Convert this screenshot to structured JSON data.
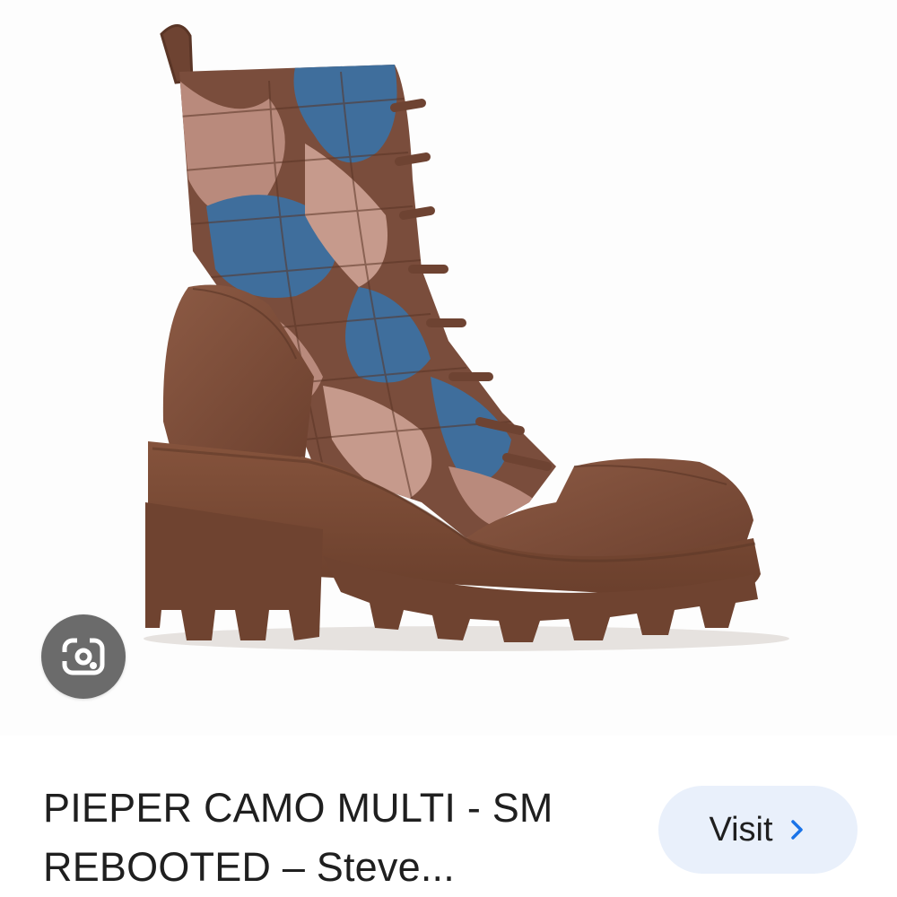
{
  "result": {
    "title_line_1": "PIEPER CAMO MULTI - SM",
    "title_line_2": "REBOOTED – Steve...",
    "image_alt": "PIEPER CAMO MULTI - SM REBOOTED boot"
  },
  "actions": {
    "visit_label": "Visit",
    "lens_icon": "google-lens-icon",
    "chevron_icon": "chevron-right-icon"
  },
  "colors": {
    "visit_bg": "#e9f0fb",
    "accent": "#1a73e8",
    "lens_bg": "#6b6b6b",
    "boot_brown": "#7a4a35",
    "camo_blue": "#3f6e9c",
    "camo_mauve": "#b98a7c"
  }
}
